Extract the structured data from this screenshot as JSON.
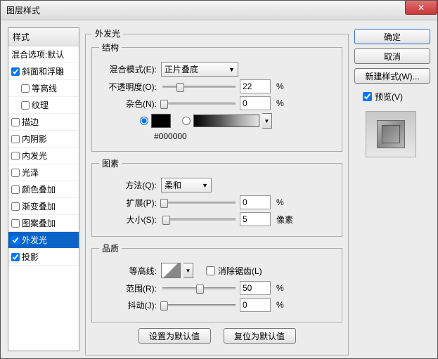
{
  "window": {
    "title": "图层样式"
  },
  "left": {
    "header": "样式",
    "blend_defaults": "混合选项:默认",
    "items": [
      {
        "label": "斜面和浮雕",
        "checked": true,
        "indent": false
      },
      {
        "label": "等高线",
        "checked": false,
        "indent": true
      },
      {
        "label": "纹理",
        "checked": false,
        "indent": true
      },
      {
        "label": "描边",
        "checked": false,
        "indent": false
      },
      {
        "label": "内阴影",
        "checked": false,
        "indent": false
      },
      {
        "label": "内发光",
        "checked": false,
        "indent": false
      },
      {
        "label": "光泽",
        "checked": false,
        "indent": false
      },
      {
        "label": "颜色叠加",
        "checked": false,
        "indent": false
      },
      {
        "label": "渐变叠加",
        "checked": false,
        "indent": false
      },
      {
        "label": "图案叠加",
        "checked": false,
        "indent": false
      },
      {
        "label": "外发光",
        "checked": true,
        "indent": false,
        "selected": true
      },
      {
        "label": "投影",
        "checked": true,
        "indent": false
      }
    ]
  },
  "center": {
    "title": "外发光",
    "structure": {
      "legend": "结构",
      "blend_mode_label": "混合模式(E):",
      "blend_mode_value": "正片叠底",
      "opacity_label": "不透明度(O):",
      "opacity_value": "22",
      "opacity_unit": "%",
      "noise_label": "杂色(N):",
      "noise_value": "0",
      "noise_unit": "%",
      "hex": "#000000"
    },
    "element": {
      "legend": "图素",
      "method_label": "方法(Q):",
      "method_value": "柔和",
      "spread_label": "扩展(P):",
      "spread_value": "0",
      "spread_unit": "%",
      "size_label": "大小(S):",
      "size_value": "5",
      "size_unit": "像素"
    },
    "quality": {
      "legend": "品质",
      "contour_label": "等高线:",
      "antialias_label": "消除锯齿(L)",
      "range_label": "范围(R):",
      "range_value": "50",
      "range_unit": "%",
      "jitter_label": "抖动(J):",
      "jitter_value": "0",
      "jitter_unit": "%"
    },
    "set_default": "设置为默认值",
    "reset_default": "复位为默认值"
  },
  "right": {
    "ok": "确定",
    "cancel": "取消",
    "new_style": "新建样式(W)...",
    "preview": "预览(V)"
  }
}
